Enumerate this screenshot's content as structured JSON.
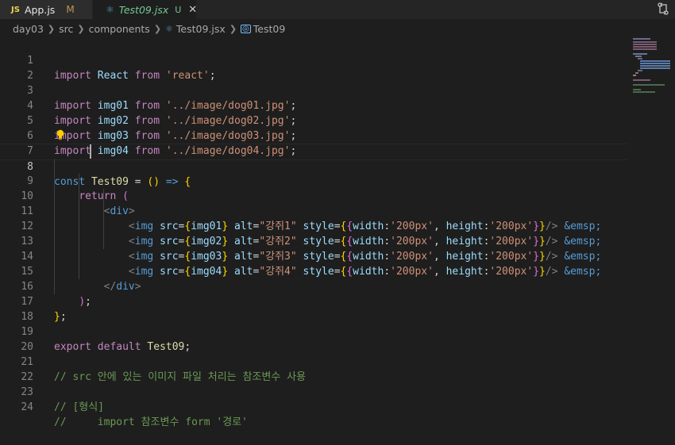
{
  "tabs": [
    {
      "badge": "JS",
      "title": "App.js",
      "status": "M"
    },
    {
      "icon": "react-icon",
      "title": "Test09.jsx",
      "status": "U",
      "close": "✕"
    }
  ],
  "breadcrumb": {
    "items": [
      "day03",
      "src",
      "components",
      "Test09.jsx",
      "Test09"
    ]
  },
  "editor": {
    "active_line": 8,
    "lines": [
      {
        "n": "1"
      },
      {
        "n": "2"
      },
      {
        "n": "3"
      },
      {
        "n": "4"
      },
      {
        "n": "5"
      },
      {
        "n": "6"
      },
      {
        "n": "7"
      },
      {
        "n": "8"
      },
      {
        "n": "9"
      },
      {
        "n": "10"
      },
      {
        "n": "11"
      },
      {
        "n": "12"
      },
      {
        "n": "13"
      },
      {
        "n": "14"
      },
      {
        "n": "15"
      },
      {
        "n": "16"
      },
      {
        "n": "17"
      },
      {
        "n": "18"
      },
      {
        "n": "19"
      },
      {
        "n": "20"
      },
      {
        "n": "21"
      },
      {
        "n": "22"
      },
      {
        "n": "23"
      },
      {
        "n": "24"
      }
    ],
    "code": {
      "l1": {
        "imp": "import",
        "id": "React",
        "from": "from",
        "str": "'react'",
        "end": ";"
      },
      "l3": {
        "imp": "import",
        "id": "img01",
        "from": "from",
        "str": "'../image/dog01.jpg'"
      },
      "l4": {
        "imp": "import",
        "id": "img02",
        "from": "from",
        "str": "'../image/dog02.jpg'"
      },
      "l5": {
        "imp": "import",
        "id": "img03",
        "from": "from",
        "str": "'../image/dog03.jpg'"
      },
      "l6": {
        "imp": "import",
        "id": "img04",
        "from": "from",
        "str": "'../image/dog04.jpg'"
      },
      "l8": {
        "kw": "const",
        "fn": "Test09",
        "eq": " = ",
        "p": "()",
        "arrow": " => ",
        "b": "{"
      },
      "l9": {
        "imp": "return",
        "p": "("
      },
      "l10": {
        "open": "<",
        "tag": "div",
        "close": ">"
      },
      "img_rows": [
        {
          "src": "img01",
          "alt": "\"강쥐1\""
        },
        {
          "src": "img02",
          "alt": "\"강쥐2\""
        },
        {
          "src": "img03",
          "alt": "\"강쥐3\""
        },
        {
          "src": "img04",
          "alt": "\"강쥐4\""
        }
      ],
      "img_tag": "img",
      "attr_src": "src",
      "attr_alt": "alt",
      "attr_style": "style",
      "w_key": "width",
      "w_val": "'200px'",
      "h_key": "height",
      "h_val": "'200px'",
      "selfclose": "/>",
      "emsp": "&emsp;",
      "l15": {
        "open": "</",
        "tag": "div",
        "close": ">"
      },
      "l16": {
        "p": ")",
        "end": ";"
      },
      "l17": {
        "b": "}",
        "end": ";"
      },
      "l19": {
        "imp": "export",
        "kw": "default",
        "id": "Test09",
        "end": ";"
      },
      "l21": "// src 안에 있는 이미지 파일 처리는 참조변수 사용",
      "l23": "// [형식]",
      "l24": "//     import 참조변수 form '경로'"
    }
  },
  "colors": {
    "keyword": "#569cd6",
    "control": "#c586c0",
    "variable": "#9cdcfe",
    "function": "#dcdcaa",
    "string": "#ce9178",
    "comment": "#6a9955"
  }
}
